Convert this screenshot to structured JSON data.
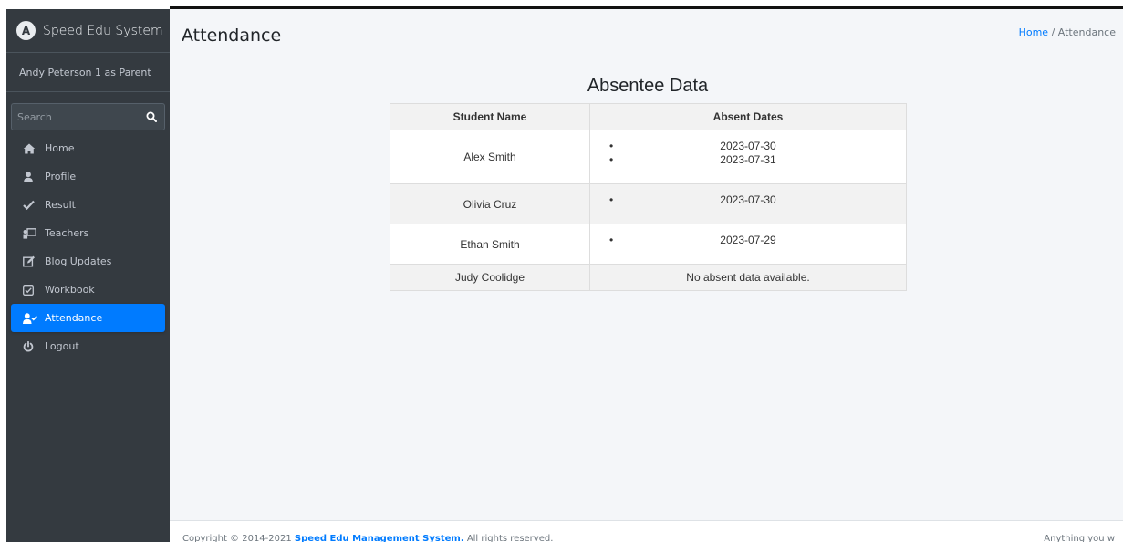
{
  "brand": {
    "name": "Speed Edu System",
    "logo_letter": "A"
  },
  "user": {
    "label": "Andy Peterson 1 as Parent"
  },
  "search": {
    "placeholder": "Search"
  },
  "nav": [
    {
      "label": "Home",
      "icon": "home-icon"
    },
    {
      "label": "Profile",
      "icon": "user-icon"
    },
    {
      "label": "Result",
      "icon": "check-icon"
    },
    {
      "label": "Teachers",
      "icon": "chalkboard-teacher-icon"
    },
    {
      "label": "Blog Updates",
      "icon": "edit-icon"
    },
    {
      "label": "Workbook",
      "icon": "check-square-icon"
    },
    {
      "label": "Attendance",
      "icon": "user-check-icon",
      "active": true
    },
    {
      "label": "Logout",
      "icon": "power-icon"
    }
  ],
  "page": {
    "title": "Attendance"
  },
  "breadcrumb": {
    "home": "Home",
    "separator": "/",
    "current": "Attendance"
  },
  "absentee": {
    "title": "Absentee Data",
    "columns": [
      "Student Name",
      "Absent Dates"
    ],
    "rows": [
      {
        "name": "Alex Smith",
        "dates": [
          "2023-07-30",
          "2023-07-31"
        ]
      },
      {
        "name": "Olivia Cruz",
        "dates": [
          "2023-07-30"
        ]
      },
      {
        "name": "Ethan Smith",
        "dates": [
          "2023-07-29"
        ]
      },
      {
        "name": "Judy Coolidge",
        "none_text": "No absent data available."
      }
    ]
  },
  "footer": {
    "copyright_prefix": "Copyright © 2014-2021",
    "company": "Speed Edu Management System.",
    "rights": "All rights reserved.",
    "right_text": "Anything you w"
  },
  "colors": {
    "sidebar": "#343a40",
    "accent": "#007bff",
    "content_bg": "#f4f6f9"
  }
}
